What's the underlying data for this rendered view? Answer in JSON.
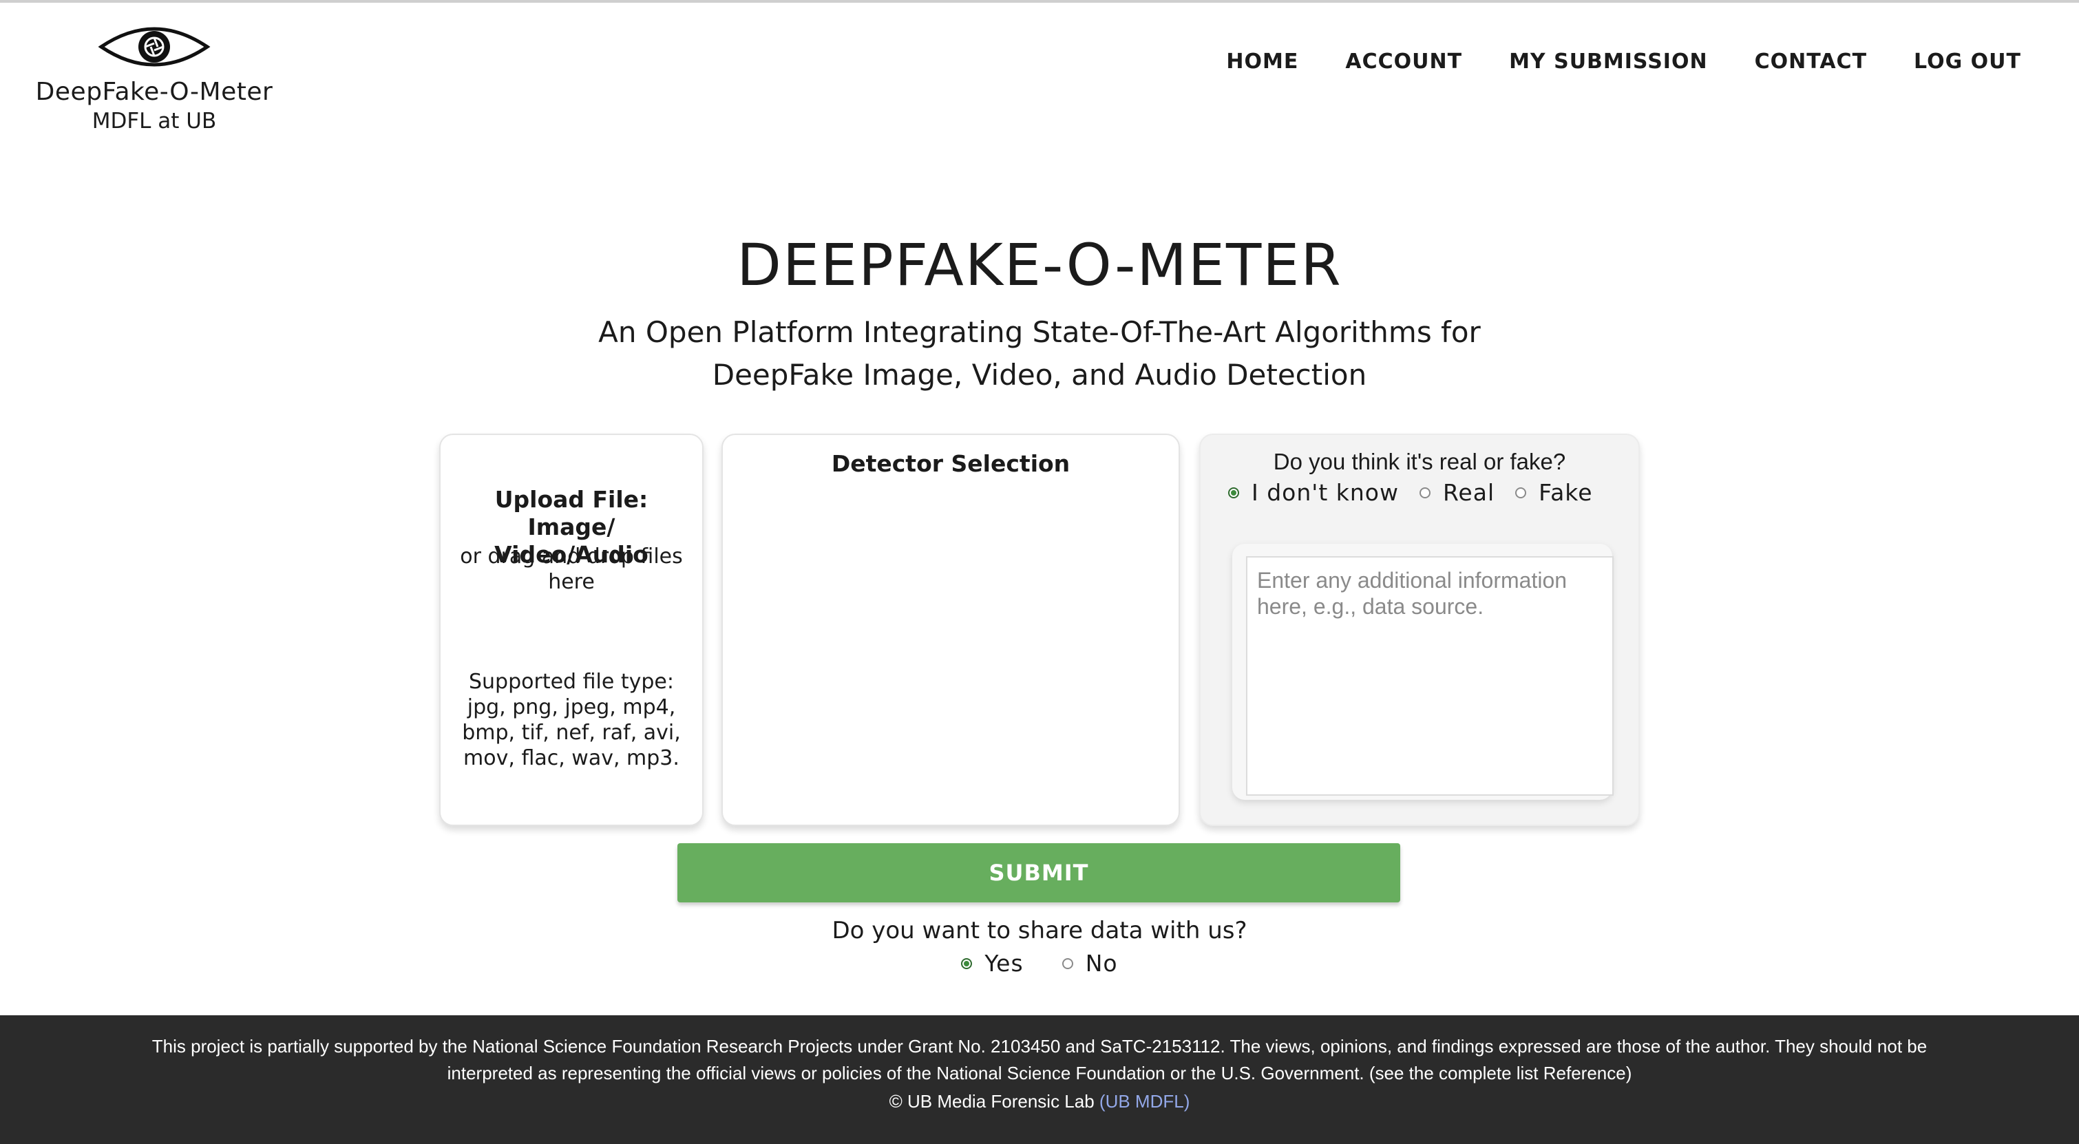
{
  "logo": {
    "title": "DeepFake-O-Meter",
    "subtitle": "MDFL at UB",
    "icon": "eye-icon"
  },
  "nav": {
    "items": [
      {
        "label": "HOME"
      },
      {
        "label": "ACCOUNT"
      },
      {
        "label": "MY SUBMISSION"
      },
      {
        "label": "CONTACT"
      },
      {
        "label": "LOG OUT"
      }
    ]
  },
  "hero": {
    "title": "DEEPFAKE-O-METER",
    "subtitle": "An Open Platform Integrating State-Of-The-Art Algorithms for DeepFake Image, Video, and Audio Detection"
  },
  "upload": {
    "title": "Upload File: Image/ Video/Audio",
    "drag_text": "or drag and drop files here",
    "supported_types": "Supported file type: jpg, png, jpeg, mp4, bmp, tif, nef, raf, avi, mov, flac, wav, mp3."
  },
  "detector": {
    "title": "Detector Selection"
  },
  "opinion": {
    "question": "Do you think it's real or fake?",
    "options": [
      {
        "label": "I don't know",
        "checked": true
      },
      {
        "label": "Real",
        "checked": false
      },
      {
        "label": "Fake",
        "checked": false
      }
    ],
    "info_placeholder": "Enter any additional information here, e.g., data source.",
    "info_value": ""
  },
  "submit": {
    "label": "SUBMIT",
    "color": "#67ae5e"
  },
  "share": {
    "question": "Do you want to share data with us?",
    "options": [
      {
        "label": "Yes",
        "checked": true
      },
      {
        "label": "No",
        "checked": false
      }
    ]
  },
  "footer": {
    "text": "This project is partially supported by the National Science Foundation Research Projects under Grant No. 2103450 and SaTC-2153112. The views, opinions, and findings expressed are those of the author. They should not be interpreted as representing the official views or policies of the National Science Foundation or the U.S. Government. (see the complete list Reference)",
    "copyright": "© UB Media Forensic Lab",
    "link_label": "(UB MDFL)"
  }
}
